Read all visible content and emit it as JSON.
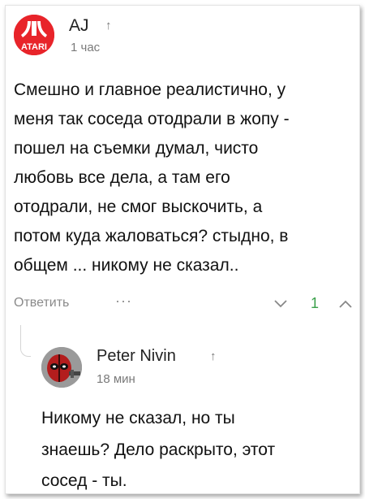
{
  "comment": {
    "author": "AJ",
    "author_avatar_text": "ATARI",
    "time": "1 час",
    "lines": [
      "Смешно и главное реалистично, у",
      "меня так соседа отодрали в жопу -",
      "пошел на съемки думал, чисто",
      "любовь все дела, а там его",
      "отодрали, не смог выскочить, а",
      "потом куда жаловаться? стыдно, в",
      "общем ... никому не сказал.."
    ],
    "reply_label": "Ответить",
    "more_label": "···",
    "rating": "1",
    "icons": {
      "arrow": "up-arrow-icon",
      "down": "chevron-down-icon",
      "up": "chevron-up-icon"
    },
    "colors": {
      "rating": "#3aa04a",
      "avatar": "#e8242a"
    }
  },
  "reply": {
    "author": "Peter Nivin",
    "time": "18 мин",
    "lines": [
      "Никому не сказал, но ты",
      "знаешь? Дело раскрыто, этот",
      "сосед - ты."
    ]
  }
}
